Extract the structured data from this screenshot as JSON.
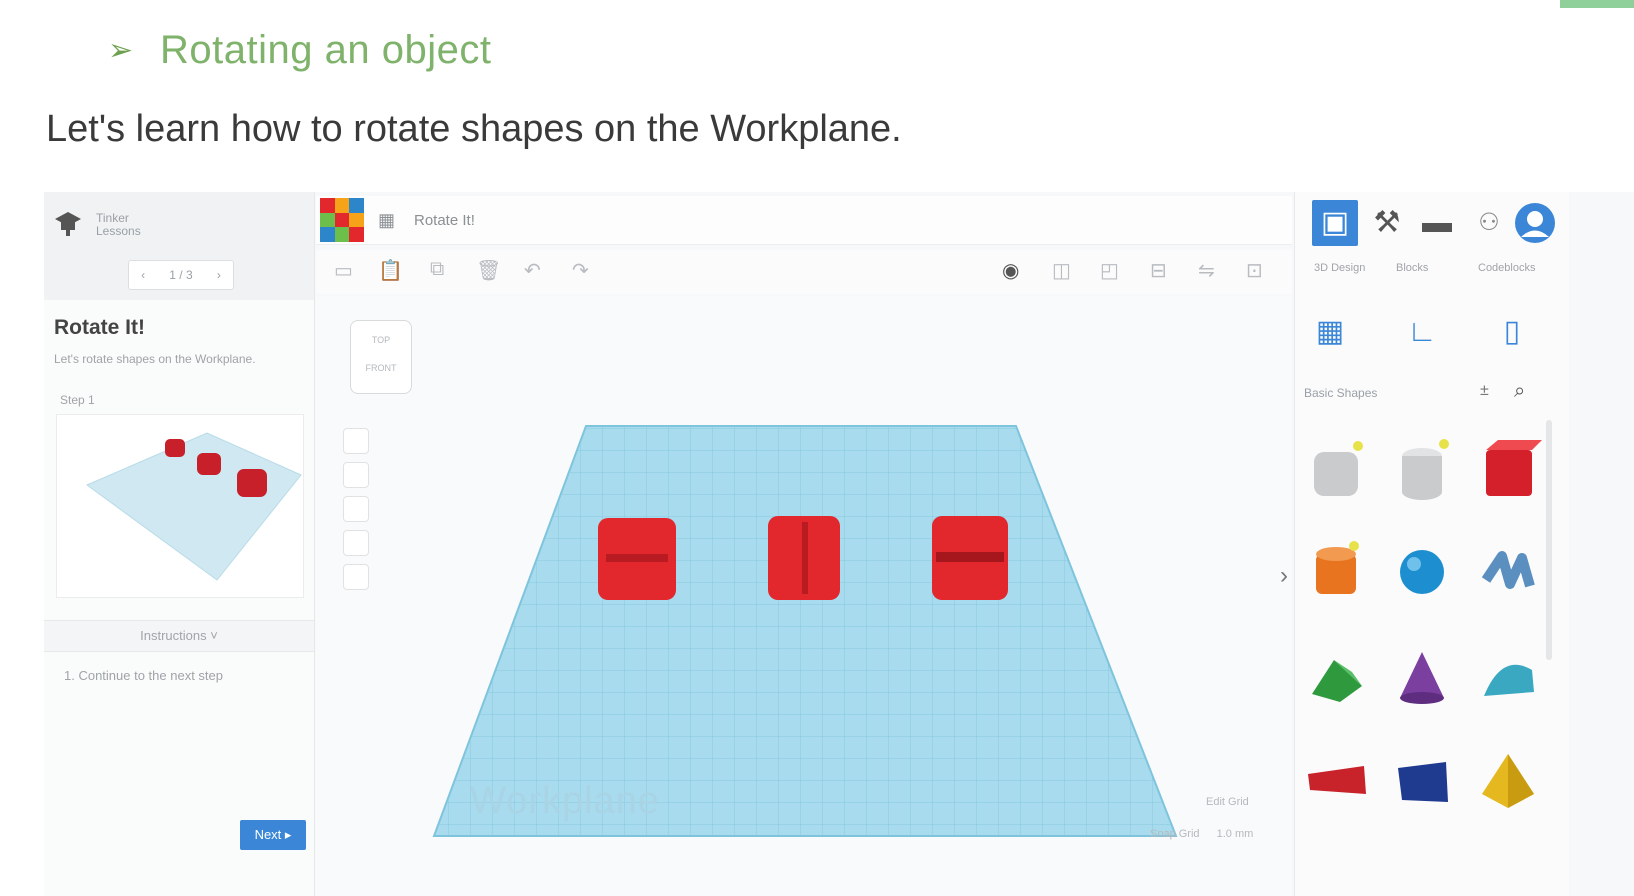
{
  "slide": {
    "bullet": "➢",
    "heading": "Rotating an object",
    "intro": "Let's learn how to rotate shapes on the Workplane."
  },
  "app": {
    "brand": {
      "line1": "Tinker",
      "line2": "Lessons"
    },
    "lesson_nav": {
      "prev": "‹",
      "pages": "1 / 3",
      "next": "›"
    },
    "lesson": {
      "title": "Rotate It!",
      "subtitle": "Let's rotate shapes on the Workplane.",
      "step": "Step 1",
      "instructions_header": "Instructions",
      "instruction_item": "1. Continue to the next step",
      "next_button": "Next ▸"
    },
    "design_title": "Rotate It!",
    "view_cube": {
      "top": "TOP",
      "front": "FRONT"
    },
    "workplane_label": "Workplane",
    "edit_grid": "Edit Grid",
    "snap_grid": "Snap Grid",
    "snap_value": "1.0 mm",
    "modes": [
      {
        "label": "3D Design",
        "icon": "grid-mode-icon"
      },
      {
        "label": "Blocks",
        "icon": "pickaxe-icon"
      },
      {
        "label": "Codeblocks",
        "icon": "brick-icon"
      }
    ],
    "shape_tools": [
      "workplane-icon",
      "ruler-icon",
      "notes-icon"
    ],
    "shapes_category": "Basic Shapes",
    "shapes": [
      {
        "name": "hole-box",
        "color": "#c9cbcd"
      },
      {
        "name": "hole-cylinder",
        "color": "#c9cbcd"
      },
      {
        "name": "box",
        "color": "#d4202a"
      },
      {
        "name": "cylinder",
        "color": "#e8741f"
      },
      {
        "name": "sphere",
        "color": "#1d8fd0"
      },
      {
        "name": "scribble",
        "color": "#5a8fc0"
      },
      {
        "name": "roof",
        "color": "#2e9a3d"
      },
      {
        "name": "cone",
        "color": "#7b3fa0"
      },
      {
        "name": "round-roof",
        "color": "#3aa8c0"
      },
      {
        "name": "text",
        "color": "#c8232b"
      },
      {
        "name": "shape-generator",
        "color": "#1f3b8f"
      },
      {
        "name": "pyramid",
        "color": "#e5b820"
      }
    ],
    "colors": {
      "workplane": "#a8dbed",
      "grid_line": "#7fc4dd",
      "box_red": "#e2272d",
      "accent_blue": "#3b86d6"
    }
  }
}
